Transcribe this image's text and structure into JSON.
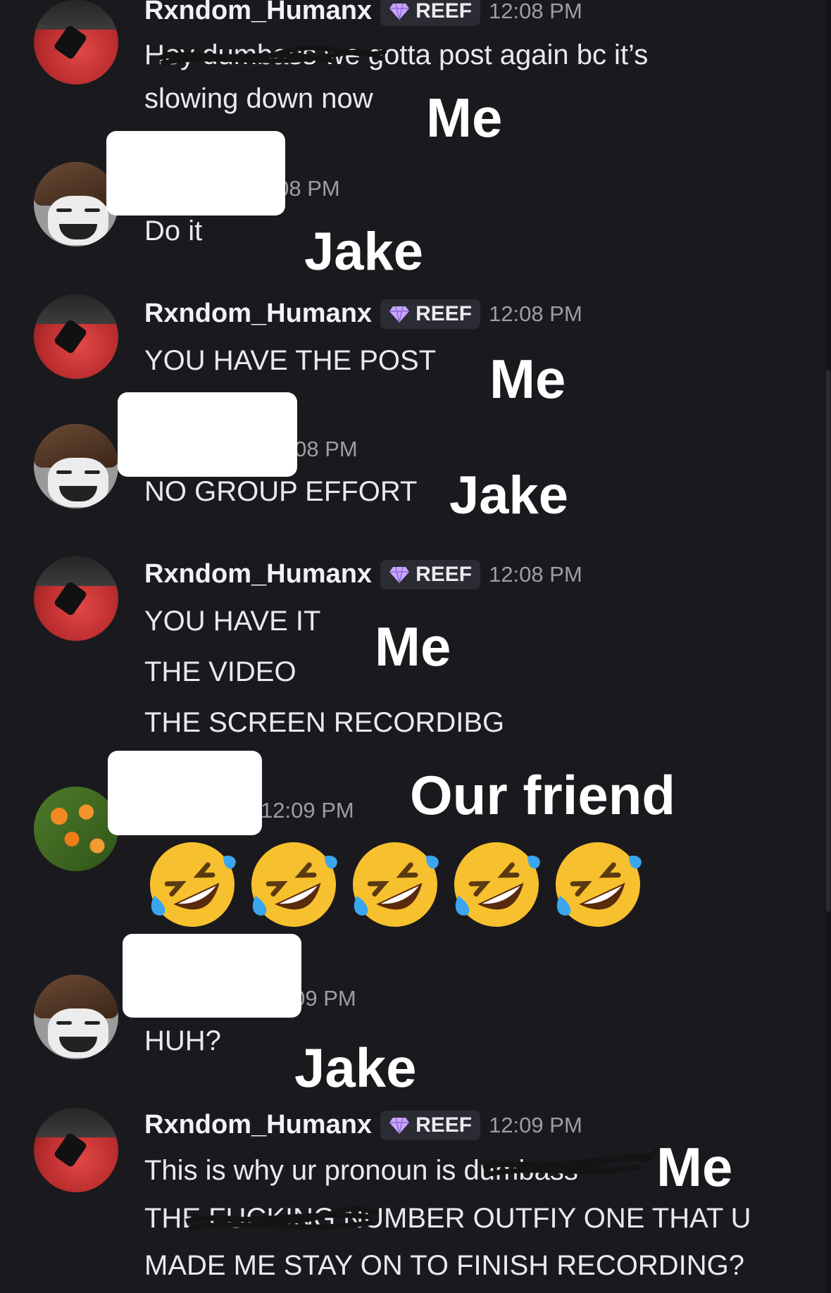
{
  "messages": [
    {
      "username": "Rxndom_Humanx",
      "badge": "REEF",
      "time": "12:08 PM",
      "lines": [
        "Hey dumbass we gotta post again bc it’s",
        "slowing down now"
      ],
      "overlay_label": "Me"
    },
    {
      "time": "12:08 PM",
      "lines": [
        "Do it"
      ],
      "overlay_label": "Jake"
    },
    {
      "username": "Rxndom_Humanx",
      "badge": "REEF",
      "time": "12:08 PM",
      "lines": [
        "YOU HAVE THE POST"
      ],
      "overlay_label": "Me"
    },
    {
      "time": "12:08 PM",
      "lines": [
        "NO GROUP EFFORT"
      ],
      "overlay_label": "Jake"
    },
    {
      "username": "Rxndom_Humanx",
      "badge": "REEF",
      "time": "12:08 PM",
      "lines": [
        "YOU HAVE IT",
        "THE VIDEO",
        "THE SCREEN RECORDIBG"
      ],
      "overlay_label": "Me"
    },
    {
      "time": "12:09 PM",
      "emoji": "rolling-on-floor-laughing",
      "emoji_count": 5,
      "overlay_label": "Our friend"
    },
    {
      "time": "12:09 PM",
      "lines": [
        "HUH?"
      ],
      "overlay_label": "Jake"
    },
    {
      "username": "Rxndom_Humanx",
      "badge": "REEF",
      "time": "12:09 PM",
      "lines": [
        "This is why ur pronoun is dumbass",
        "THE FUCKING NUMBER OUTFIY ONE THAT U",
        "MADE ME STAY ON TO FINISH RECORDING?"
      ],
      "overlay_label": "Me"
    }
  ],
  "colors": {
    "background": "#1a1a1e",
    "badge_bg": "#2b2b33",
    "badge_gem": "#c9a6ff",
    "timestamp": "#9d9da6",
    "emoji_face": "#f7c02e",
    "tears": "#3aa6ef"
  }
}
